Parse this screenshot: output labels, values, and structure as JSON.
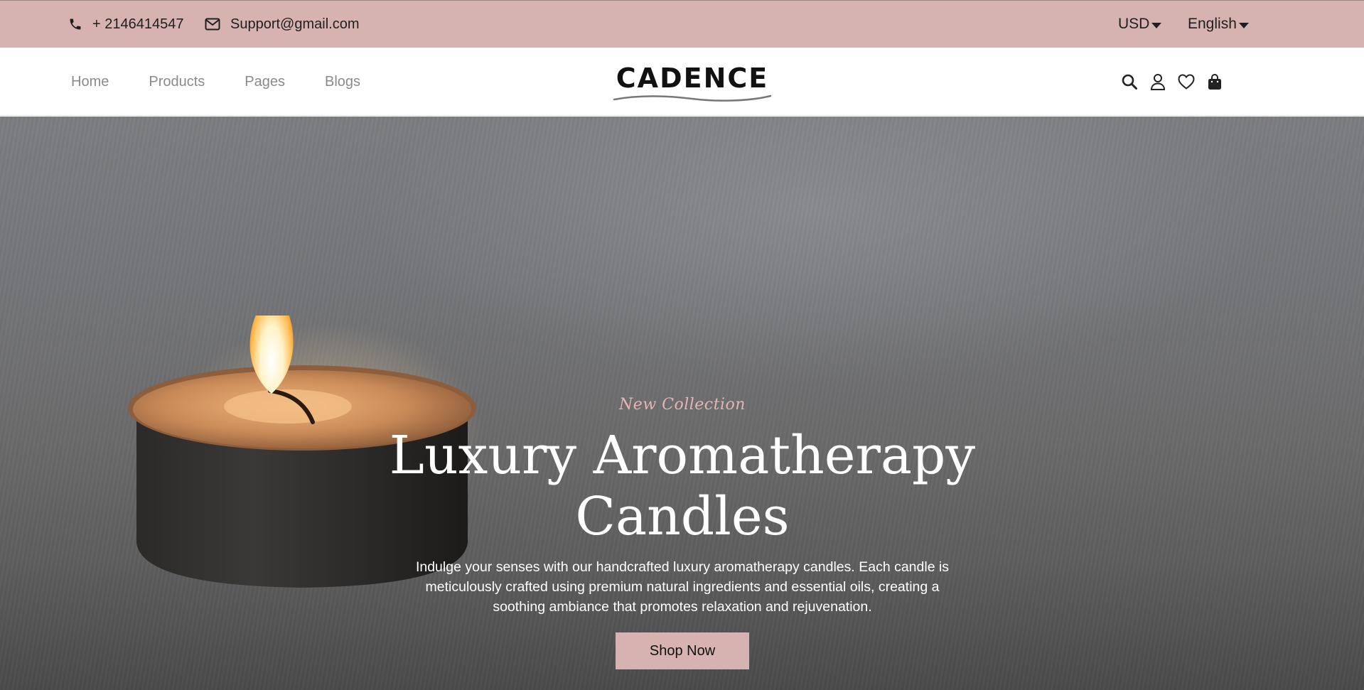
{
  "topbar": {
    "phone": "+ 2146414547",
    "email": "Support@gmail.com",
    "currency": "USD",
    "language": "English",
    "background_color": "#d6b3b1"
  },
  "header": {
    "nav": [
      {
        "label": "Home"
      },
      {
        "label": "Products"
      },
      {
        "label": "Pages"
      },
      {
        "label": "Blogs"
      }
    ],
    "logo_text": "CADENCE",
    "icons": [
      "search-icon",
      "user-icon",
      "heart-icon",
      "shopping-bag-icon"
    ]
  },
  "hero": {
    "eyebrow": "New Collection",
    "headline_line1": "Luxury Aromatherapy",
    "headline_line2": "Candles",
    "description": "Indulge your senses with our handcrafted luxury aromatherapy candles. Each candle is meticulously crafted using premium natural ingredients and essential oils, creating a soothing ambiance that promotes relaxation and rejuvenation.",
    "cta_label": "Shop Now",
    "accent_color": "#e3b5b6"
  }
}
